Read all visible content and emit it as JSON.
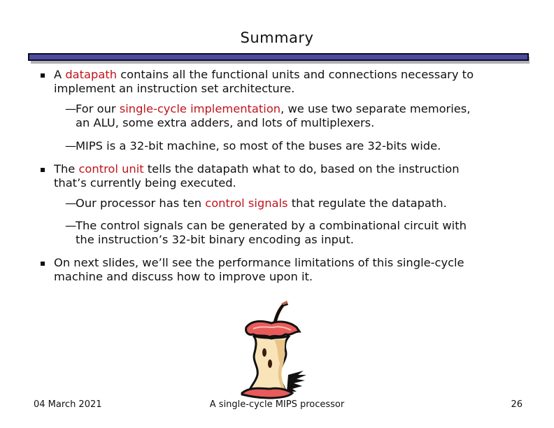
{
  "title": "Summary",
  "bullets": [
    {
      "parts": [
        {
          "text": "A ",
          "hl": false
        },
        {
          "text": "datapath",
          "hl": true
        },
        {
          "text": " contains all the functional units and connections necessary to",
          "hl": false
        }
      ],
      "cont": "implement an instruction set architecture.",
      "subs": [
        {
          "parts": [
            {
              "text": "For our ",
              "hl": false
            },
            {
              "text": "single-cycle implementation",
              "hl": true
            },
            {
              "text": ", we use two separate memories,",
              "hl": false
            }
          ],
          "cont": "an ALU, some extra adders, and lots of multiplexers."
        },
        {
          "parts": [
            {
              "text": "MIPS is a 32-bit machine, so most of the buses are 32-bits wide.",
              "hl": false
            }
          ],
          "cont": ""
        }
      ]
    },
    {
      "parts": [
        {
          "text": "The ",
          "hl": false
        },
        {
          "text": "control unit",
          "hl": true
        },
        {
          "text": " tells the datapath what to do, based on the instruction",
          "hl": false
        }
      ],
      "cont": "that’s currently being executed.",
      "subs": [
        {
          "parts": [
            {
              "text": "Our processor has ten ",
              "hl": false
            },
            {
              "text": "control signals",
              "hl": true
            },
            {
              "text": " that regulate the datapath.",
              "hl": false
            }
          ],
          "cont": ""
        },
        {
          "parts": [
            {
              "text": "The control signals can be generated by a combinational circuit with",
              "hl": false
            }
          ],
          "cont": "the instruction’s 32-bit binary encoding as input."
        }
      ]
    },
    {
      "parts": [
        {
          "text": "On next slides, we’ll see the performance limitations of this single-cycle",
          "hl": false
        }
      ],
      "cont": "machine and discuss how to improve upon it.",
      "subs": []
    }
  ],
  "dash_glyph": "—",
  "image": {
    "icon": "apple-core-icon"
  },
  "footer": {
    "date": "04 March 2021",
    "center": "A single-cycle MIPS processor",
    "page": "26"
  },
  "colors": {
    "highlight": "#c0141c",
    "rule_fill": "#4b4ba0",
    "rule_border": "#0c0c1e",
    "rule_shadow": "#b0b0b8"
  }
}
